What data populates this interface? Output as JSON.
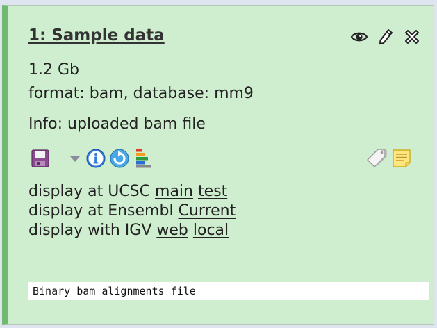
{
  "dataset": {
    "title": "1: Sample data",
    "size": "1.2 Gb",
    "format_line": "format: bam, database: mm9",
    "info": "Info: uploaded bam file",
    "display": [
      {
        "prefix": "display at UCSC",
        "links": [
          "main",
          "test"
        ]
      },
      {
        "prefix": "display at Ensembl",
        "links": [
          "Current"
        ]
      },
      {
        "prefix": "display with IGV",
        "links": [
          "web",
          "local"
        ]
      }
    ],
    "peek": "Binary bam alignments file"
  },
  "title_icons": [
    "eye-icon",
    "pencil-icon",
    "delete-x-icon"
  ],
  "toolbar_icons": [
    "save-icon",
    "dropdown-arrow-icon",
    "info-icon",
    "rerun-icon",
    "visualize-bars-icon",
    "tags-icon",
    "annotation-note-icon"
  ],
  "colors": {
    "panel_bg": "#cfeecf",
    "panel_accent": "#6fba6f",
    "peek_bg": "#ffffff"
  }
}
